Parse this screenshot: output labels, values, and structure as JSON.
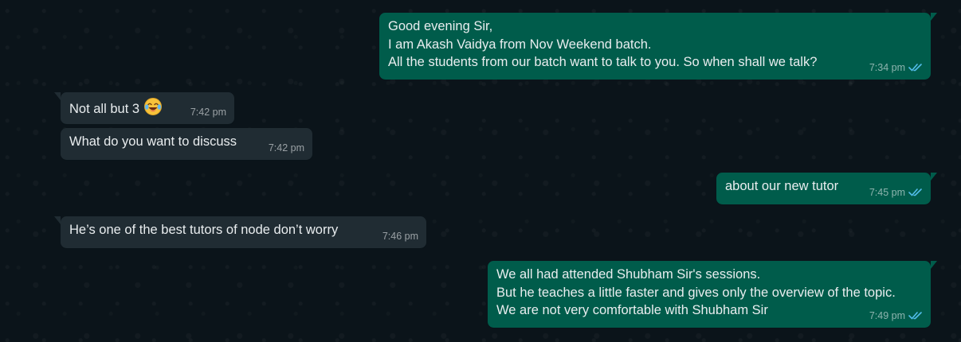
{
  "messages": [
    {
      "direction": "out",
      "lines": [
        "Good evening Sir,",
        "I am Akash Vaidya from Nov Weekend batch.",
        "All the students from our batch want to talk to you. So when shall we talk?"
      ],
      "time": "7:34 pm",
      "status_icon": "double-check-icon"
    },
    {
      "direction": "in",
      "lines": [
        "Not all but 3"
      ],
      "emoji": "face-with-tears-of-joy",
      "time": "7:42 pm"
    },
    {
      "direction": "in",
      "lines": [
        "What do you want to discuss"
      ],
      "time": "7:42 pm"
    },
    {
      "direction": "out",
      "lines": [
        "about our new tutor"
      ],
      "time": "7:45 pm",
      "status_icon": "double-check-icon"
    },
    {
      "direction": "in",
      "lines": [
        "He’s one of the best tutors of node don’t worry"
      ],
      "time": "7:46 pm"
    },
    {
      "direction": "out",
      "lines": [
        "We all had attended Shubham Sir's sessions.",
        "But he teaches a little faster and gives only the overview of the topic.",
        "We are not very comfortable with Shubham Sir"
      ],
      "time": "7:49 pm",
      "status_icon": "double-check-icon"
    }
  ],
  "colors": {
    "background": "#0b141a",
    "outgoing_bubble": "#005c4b",
    "incoming_bubble": "#202c33",
    "text": "#e9edef",
    "read_ticks": "#53bdeb"
  }
}
